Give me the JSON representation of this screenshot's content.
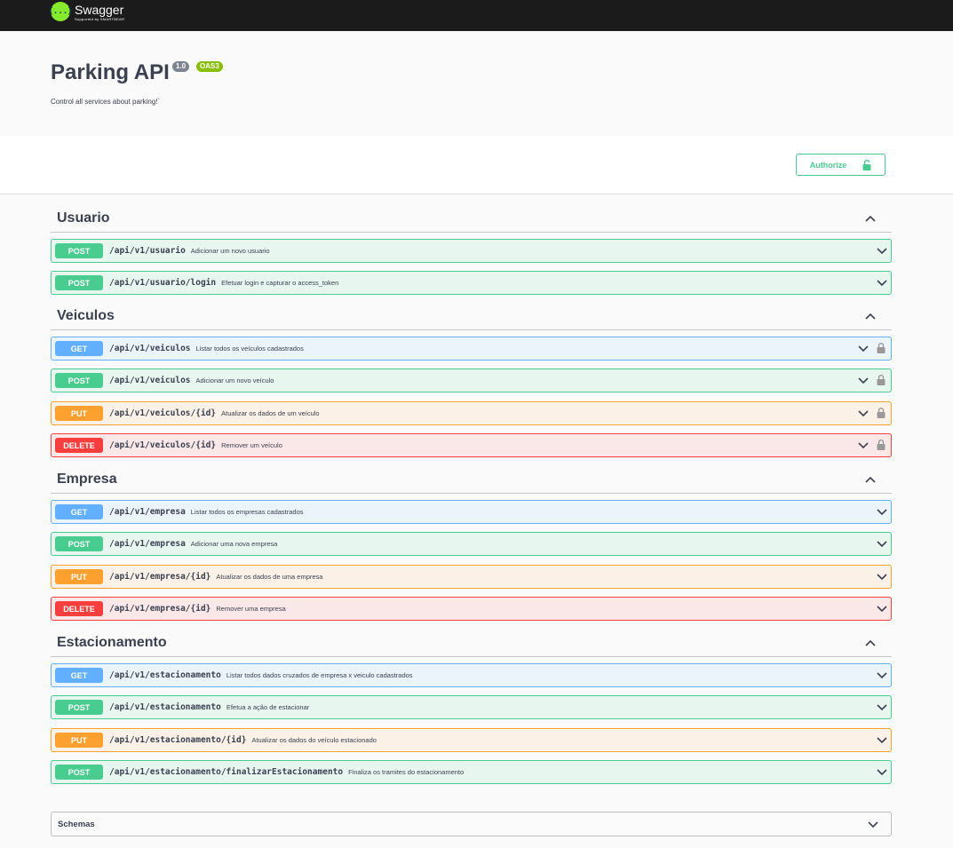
{
  "header": {
    "logo_mark": "{...}",
    "logo_name": "Swagger",
    "logo_sub": "Supported by SMARTBEAR"
  },
  "info": {
    "title": "Parking API",
    "version": "1.0",
    "oas": "OAS3",
    "description": "Control all services about parking!`"
  },
  "authorize": {
    "label": "Authorize"
  },
  "tags": [
    {
      "name": "Usuario",
      "operations": [
        {
          "method": "POST",
          "path": "/api/v1/usuario",
          "summary": "Adicionar um novo usuario"
        },
        {
          "method": "POST",
          "path": "/api/v1/usuario/login",
          "summary": "Efetuar login e capturar o access_token"
        }
      ]
    },
    {
      "name": "Veiculos",
      "operations": [
        {
          "method": "GET",
          "path": "/api/v1/veiculos",
          "summary": "Listar todos os veículos cadastrados"
        },
        {
          "method": "POST",
          "path": "/api/v1/veiculos",
          "summary": "Adicionar um novo veículo"
        },
        {
          "method": "PUT",
          "path": "/api/v1/veiculos/{id}",
          "summary": "Atualizar os dados de um veículo"
        },
        {
          "method": "DELETE",
          "path": "/api/v1/veiculos/{id}",
          "summary": "Remover um veículo"
        }
      ]
    },
    {
      "name": "Empresa",
      "operations": [
        {
          "method": "GET",
          "path": "/api/v1/empresa",
          "summary": "Listar todos os empresas cadastrados"
        },
        {
          "method": "POST",
          "path": "/api/v1/empresa",
          "summary": "Adicionar uma nova empresa"
        },
        {
          "method": "PUT",
          "path": "/api/v1/empresa/{id}",
          "summary": "Atualizar os dados de uma empresa"
        },
        {
          "method": "DELETE",
          "path": "/api/v1/empresa/{id}",
          "summary": "Remover uma empresa"
        }
      ]
    },
    {
      "name": "Estacionamento",
      "operations": [
        {
          "method": "GET",
          "path": "/api/v1/estacionamento",
          "summary": "Listar todos dados cruzados de empresa x veiculo cadastrados"
        },
        {
          "method": "POST",
          "path": "/api/v1/estacionamento",
          "summary": "Efetua a ação de estacionar"
        },
        {
          "method": "PUT",
          "path": "/api/v1/estacionamento/{id}",
          "summary": "Atualizar os dados do veículo estacionado"
        },
        {
          "method": "POST",
          "path": "/api/v1/estacionamento/finalizarEstacionamento",
          "summary": "Finaliza os tramites do estacionamento"
        }
      ]
    }
  ],
  "schemas": {
    "label": "Schemas"
  },
  "colors": {
    "post": "#49cc90",
    "get": "#61affe",
    "put": "#fca130",
    "delete": "#f93e3e",
    "brand": "#85ea2d"
  }
}
